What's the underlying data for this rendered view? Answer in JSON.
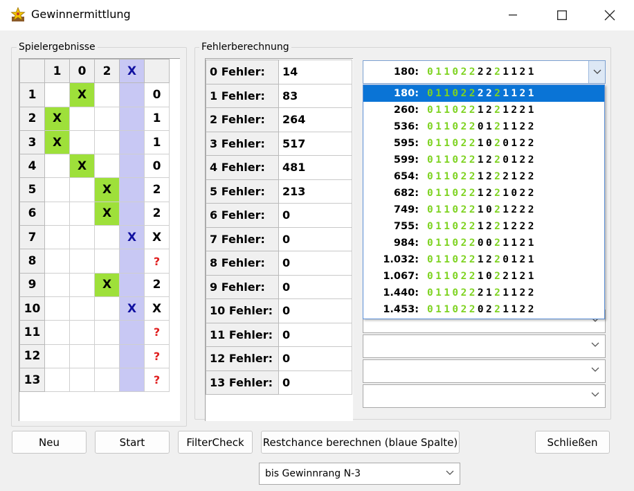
{
  "window": {
    "title": "Gewinnermittlung",
    "icon": "star-trophy-icon"
  },
  "groups": {
    "results_label": "Spielergebnisse",
    "errors_label": "Fehlerberechnung"
  },
  "results": {
    "headers": [
      "1",
      "0",
      "2",
      "X"
    ],
    "rows": [
      {
        "n": "1",
        "mark": "0",
        "result": "0"
      },
      {
        "n": "2",
        "mark": "1",
        "result": "1"
      },
      {
        "n": "3",
        "mark": "1",
        "result": "1"
      },
      {
        "n": "4",
        "mark": "0",
        "result": "0"
      },
      {
        "n": "5",
        "mark": "2",
        "result": "2"
      },
      {
        "n": "6",
        "mark": "2",
        "result": "2"
      },
      {
        "n": "7",
        "mark": "X",
        "result": "X"
      },
      {
        "n": "8",
        "mark": "",
        "result": "?"
      },
      {
        "n": "9",
        "mark": "2",
        "result": "2"
      },
      {
        "n": "10",
        "mark": "X",
        "result": "X"
      },
      {
        "n": "11",
        "mark": "",
        "result": "?"
      },
      {
        "n": "12",
        "mark": "",
        "result": "?"
      },
      {
        "n": "13",
        "mark": "",
        "result": "?"
      }
    ],
    "mark_symbol": "X",
    "green_color": "#9ee03a",
    "blue_color": "#c8c8f4"
  },
  "errors": [
    {
      "label": "0 Fehler:",
      "value": "14"
    },
    {
      "label": "1 Fehler:",
      "value": "83"
    },
    {
      "label": "2 Fehler:",
      "value": "264"
    },
    {
      "label": "3 Fehler:",
      "value": "517"
    },
    {
      "label": "4 Fehler:",
      "value": "481"
    },
    {
      "label": "5 Fehler:",
      "value": "213"
    },
    {
      "label": "6 Fehler:",
      "value": "0"
    },
    {
      "label": "7 Fehler:",
      "value": "0"
    },
    {
      "label": "8 Fehler:",
      "value": "0"
    },
    {
      "label": "9 Fehler:",
      "value": "0"
    },
    {
      "label": "10 Fehler:",
      "value": "0"
    },
    {
      "label": "11 Fehler:",
      "value": "0"
    },
    {
      "label": "12 Fehler:",
      "value": "0"
    },
    {
      "label": "13 Fehler:",
      "value": "0"
    }
  ],
  "combo_selected": {
    "num": "180:",
    "digits": "0110222221121"
  },
  "dropdown_items": [
    {
      "num": "180:",
      "digits": "0110222221121"
    },
    {
      "num": "260:",
      "digits": "0110221221221"
    },
    {
      "num": "536:",
      "digits": "0110220121122"
    },
    {
      "num": "595:",
      "digits": "0110221020122"
    },
    {
      "num": "599:",
      "digits": "0110221220122"
    },
    {
      "num": "654:",
      "digits": "0110221222122"
    },
    {
      "num": "682:",
      "digits": "0110221221022"
    },
    {
      "num": "749:",
      "digits": "0110221021222"
    },
    {
      "num": "755:",
      "digits": "0110221221222"
    },
    {
      "num": "984:",
      "digits": "0110220021121"
    },
    {
      "num": "1.032:",
      "digits": "0110221220121"
    },
    {
      "num": "1.067:",
      "digits": "0110221022121"
    },
    {
      "num": "1.440:",
      "digits": "0110222121122"
    },
    {
      "num": "1.453:",
      "digits": "0110220221122"
    }
  ],
  "buttons": {
    "neu": "Neu",
    "start": "Start",
    "filtercheck": "FilterCheck",
    "restchance": "Restchance berechnen (blaue Spalte)",
    "schliessen": "Schließen"
  },
  "rank_select": {
    "value": "bis Gewinnrang N-3"
  },
  "colors": {
    "digit_green": "#7ed321",
    "selection_blue": "#0a74d6"
  }
}
